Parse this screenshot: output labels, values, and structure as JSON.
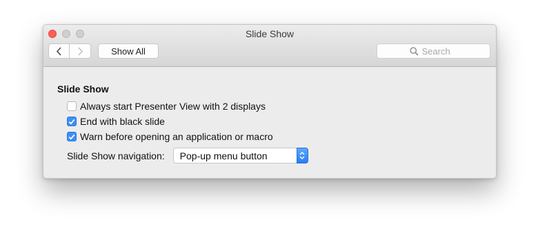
{
  "window": {
    "title": "Slide Show",
    "lights": [
      "close-icon",
      "minimize-icon",
      "zoom-icon"
    ]
  },
  "toolbar": {
    "back_icon": "chevron-left-icon",
    "forward_icon": "chevron-right-icon",
    "show_all_label": "Show All",
    "search_placeholder": "Search",
    "search_icon": "magnifier-icon"
  },
  "section": {
    "title": "Slide Show",
    "options": [
      {
        "label": "Always start Presenter View with 2 displays",
        "checked": false
      },
      {
        "label": "End with black slide",
        "checked": true
      },
      {
        "label": "Warn before opening an application or macro",
        "checked": true
      }
    ],
    "navigation": {
      "label": "Slide Show navigation:",
      "selected": "Pop-up menu button"
    }
  },
  "colors": {
    "accent": "#3c8ef7",
    "close": "#fc5f57"
  }
}
